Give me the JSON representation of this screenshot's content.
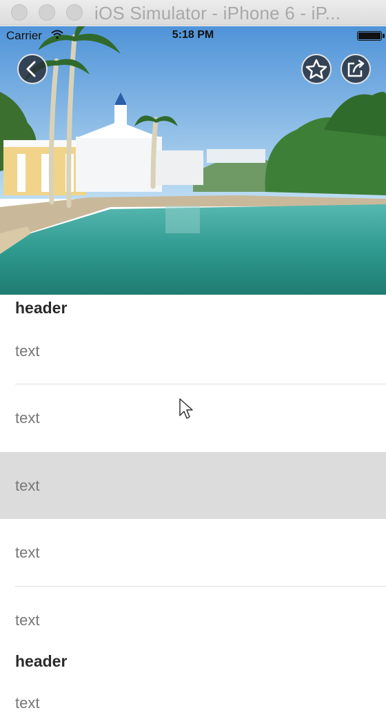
{
  "window": {
    "title": "iOS Simulator - iPhone 6 - iP..."
  },
  "status_bar": {
    "carrier": "Carrier",
    "time": "5:18 PM",
    "battery_level": 1.0
  },
  "toolbar": {
    "back_icon": "chevron-left-icon",
    "favorite_icon": "star-icon",
    "share_icon": "share-icon"
  },
  "sections": [
    {
      "header": "header",
      "rows": [
        {
          "text": "text"
        },
        {
          "text": "text"
        },
        {
          "text": "text",
          "selected": true
        },
        {
          "text": "text"
        },
        {
          "text": "text"
        }
      ]
    },
    {
      "header": "header",
      "rows": [
        {
          "text": "text"
        }
      ]
    }
  ],
  "colors": {
    "selected_row": "#dcdcdc",
    "header_text": "#2a2a2a",
    "row_text": "#777777"
  }
}
